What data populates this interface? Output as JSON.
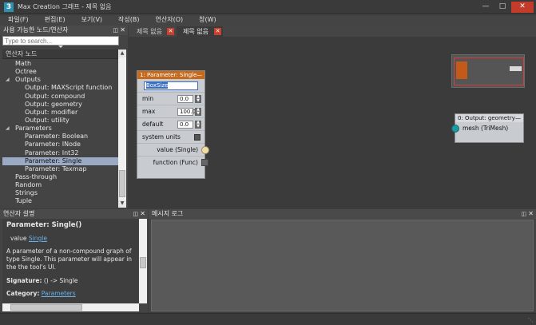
{
  "window": {
    "title": "Max Creation 그래프 - 제목 없음",
    "app_icon": "3"
  },
  "menu": [
    "파일(F)",
    "편집(E)",
    "보기(V)",
    "작성(B)",
    "연산자(O)",
    "창(W)"
  ],
  "explorer": {
    "title": "사용 가능한 노드/연산자",
    "search_placeholder": "Type to search...",
    "tree_header": "연산자 노드",
    "items": [
      {
        "label": "Math",
        "level": 0,
        "expanded": false
      },
      {
        "label": "Octree",
        "level": 0,
        "expanded": false
      },
      {
        "label": "Outputs",
        "level": 0,
        "expanded": true
      },
      {
        "label": "Output: MAXScript function",
        "level": 1
      },
      {
        "label": "Output: compound",
        "level": 1
      },
      {
        "label": "Output: geometry",
        "level": 1
      },
      {
        "label": "Output: modifier",
        "level": 1
      },
      {
        "label": "Output: utility",
        "level": 1
      },
      {
        "label": "Parameters",
        "level": 0,
        "expanded": true
      },
      {
        "label": "Parameter: Boolean",
        "level": 1
      },
      {
        "label": "Parameter: INode",
        "level": 1
      },
      {
        "label": "Parameter: Int32",
        "level": 1
      },
      {
        "label": "Parameter: Single",
        "level": 1,
        "selected": true
      },
      {
        "label": "Parameter: Texmap",
        "level": 1
      },
      {
        "label": "Pass-through",
        "level": 0,
        "expanded": false
      },
      {
        "label": "Random",
        "level": 0,
        "expanded": false
      },
      {
        "label": "Strings",
        "level": 0,
        "expanded": false
      },
      {
        "label": "Tuple",
        "level": 0,
        "expanded": false
      }
    ]
  },
  "tabs": [
    {
      "label": "제목 없음",
      "active": false
    },
    {
      "label": "제목 없음",
      "active": true
    }
  ],
  "param_node": {
    "title": "1: Parameter: Single",
    "name_value": "BoxSize",
    "min_label": "min",
    "min_value": "0.0",
    "max_label": "max",
    "max_value": "100.0",
    "default_label": "default",
    "default_value": "0.0",
    "system_units_label": "system units",
    "value_port": "value (Single)",
    "function_port": "function (Func)"
  },
  "output_node": {
    "title": "0: Output: geometry",
    "mesh_port": "mesh (TriMesh)"
  },
  "description": {
    "title": "연산자 설명",
    "heading": "Parameter: Single()",
    "value_prefix": "value",
    "value_link": "Single",
    "body": "A parameter of a non-compound graph of type Single. This parameter will appear in the the tool's UI.",
    "signature_label": "Signature:",
    "signature": "() -> Single",
    "category_label": "Category:",
    "category_link": "Parameters"
  },
  "log": {
    "title": "메시지 로그"
  },
  "colors": {
    "accent_node": "#c86a1e",
    "selection": "#9aa9c4",
    "close": "#c33c2b",
    "port_in": "#1d9aa0"
  }
}
